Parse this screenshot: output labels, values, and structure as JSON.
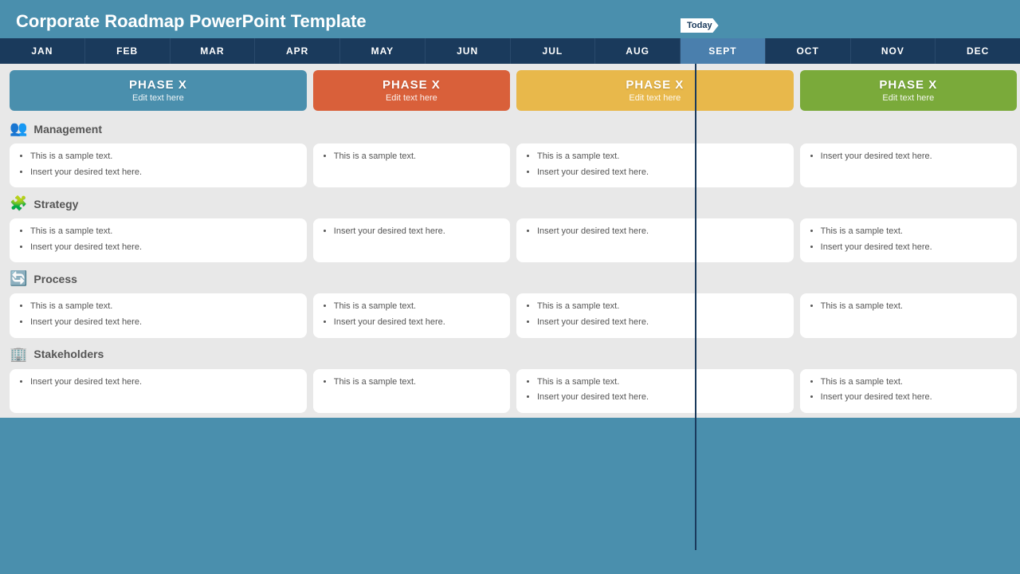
{
  "title": "Corporate Roadmap PowerPoint Template",
  "today_label": "Today",
  "months": [
    {
      "label": "JAN",
      "current": false
    },
    {
      "label": "FEB",
      "current": false
    },
    {
      "label": "MAR",
      "current": false
    },
    {
      "label": "APR",
      "current": false
    },
    {
      "label": "MAY",
      "current": false
    },
    {
      "label": "JUN",
      "current": false
    },
    {
      "label": "JUL",
      "current": false
    },
    {
      "label": "AUG",
      "current": false
    },
    {
      "label": "SEPT",
      "current": true
    },
    {
      "label": "OCT",
      "current": false
    },
    {
      "label": "NOV",
      "current": false
    },
    {
      "label": "DEC",
      "current": false
    }
  ],
  "phases": [
    {
      "label": "PHASE X",
      "sublabel": "Edit text here",
      "color": "#4a8fad"
    },
    {
      "label": "PHASE X",
      "sublabel": "Edit text here",
      "color": "#d9603a"
    },
    {
      "label": "PHASE X",
      "sublabel": "Edit text here",
      "color": "#e8b84b"
    },
    {
      "label": "PHASE X",
      "sublabel": "Edit text here",
      "color": "#7aaa3a"
    }
  ],
  "sections": [
    {
      "title": "Management",
      "icon": "👥",
      "cards": [
        [
          "This is a sample text.",
          "Insert your desired text here."
        ],
        [
          "This is a sample text."
        ],
        [
          "This is a sample text.",
          "Insert your desired text here."
        ],
        [
          "Insert your desired text here."
        ]
      ]
    },
    {
      "title": "Strategy",
      "icon": "🧩",
      "cards": [
        [
          "This is a sample text.",
          "Insert your desired text here."
        ],
        [
          "Insert your desired text here."
        ],
        [
          "Insert your desired text here."
        ],
        [
          "This is a sample text.",
          "Insert your desired text here."
        ]
      ]
    },
    {
      "title": "Process",
      "icon": "🔄",
      "cards": [
        [
          "This is a sample text.",
          "Insert your desired text here."
        ],
        [
          "This is a sample text.",
          "Insert your desired text here."
        ],
        [
          "This is a sample text.",
          "Insert your desired text here."
        ],
        [
          "This is a sample text."
        ]
      ]
    },
    {
      "title": "Stakeholders",
      "icon": "🏢",
      "cards": [
        [
          "Insert your desired text here."
        ],
        [
          "This is a sample text."
        ],
        [
          "This is a sample text.",
          "Insert your desired text here."
        ],
        [
          "This is a sample text.",
          "Insert your desired text here."
        ]
      ]
    }
  ]
}
